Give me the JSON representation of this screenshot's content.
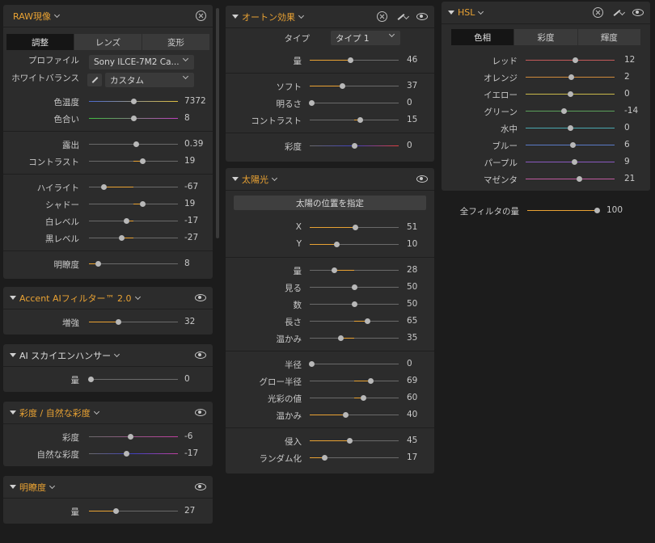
{
  "raw": {
    "title": "RAW現像",
    "tabs": [
      "調整",
      "レンズ",
      "変形"
    ],
    "profile_label": "プロファイル",
    "profile_value": "Sony ILCE-7M2 Ca...",
    "wb_label": "ホワイトバランス",
    "wb_value": "カスタム",
    "groups": [
      [
        {
          "label": "色温度",
          "value": "7372",
          "pos": 0.5
        },
        {
          "label": "色合い",
          "value": "8",
          "pos": 0.5
        }
      ],
      [
        {
          "label": "露出",
          "value": "0.39",
          "pos": 0.53
        },
        {
          "label": "コントラスト",
          "value": "19",
          "pos": 0.6
        }
      ],
      [
        {
          "label": "ハイライト",
          "value": "-67",
          "pos": 0.17
        },
        {
          "label": "シャドー",
          "value": "19",
          "pos": 0.6
        },
        {
          "label": "白レベル",
          "value": "-17",
          "pos": 0.42
        },
        {
          "label": "黒レベル",
          "value": "-27",
          "pos": 0.37
        }
      ],
      [
        {
          "label": "明瞭度",
          "value": "8",
          "pos": 0.1
        }
      ]
    ]
  },
  "accent": {
    "title": "Accent AIフィルター™ 2.0",
    "rows": [
      {
        "label": "増強",
        "value": "32",
        "pos": 0.33
      }
    ]
  },
  "sky": {
    "title": "AI スカイエンハンサー",
    "rows": [
      {
        "label": "量",
        "value": "0",
        "pos": 0.02
      }
    ]
  },
  "sat": {
    "title": "彩度 / 自然な彩度",
    "rows": [
      {
        "label": "彩度",
        "value": "-6",
        "pos": 0.47
      },
      {
        "label": "自然な彩度",
        "value": "-17",
        "pos": 0.42
      }
    ]
  },
  "clarity": {
    "title": "明瞭度",
    "rows": [
      {
        "label": "量",
        "value": "27",
        "pos": 0.3
      }
    ]
  },
  "auto": {
    "title": "オートン効果",
    "type_label": "タイプ",
    "type_value": "タイプ 1",
    "groups": [
      [
        {
          "label": "量",
          "value": "46",
          "pos": 0.46
        }
      ],
      [
        {
          "label": "ソフト",
          "value": "37",
          "pos": 0.37
        },
        {
          "label": "明るさ",
          "value": "0",
          "pos": 0.02
        },
        {
          "label": "コントラスト",
          "value": "15",
          "pos": 0.57
        }
      ],
      [
        {
          "label": "彩度",
          "value": "0",
          "pos": 0.5
        }
      ]
    ]
  },
  "sun": {
    "title": "太陽光",
    "button": "太陽の位置を指定",
    "groups": [
      [
        {
          "label": "X",
          "value": "51",
          "pos": 0.51
        },
        {
          "label": "Y",
          "value": "10",
          "pos": 0.3
        }
      ],
      [
        {
          "label": "量",
          "value": "28",
          "pos": 0.28
        },
        {
          "label": "見る",
          "value": "50",
          "pos": 0.5
        },
        {
          "label": "数",
          "value": "50",
          "pos": 0.5
        },
        {
          "label": "長さ",
          "value": "65",
          "pos": 0.65
        },
        {
          "label": "温かみ",
          "value": "35",
          "pos": 0.35
        }
      ],
      [
        {
          "label": "半径",
          "value": "0",
          "pos": 0.02
        },
        {
          "label": "グロー半径",
          "value": "69",
          "pos": 0.69
        },
        {
          "label": "光彩の値",
          "value": "60",
          "pos": 0.6
        },
        {
          "label": "温かみ",
          "value": "40",
          "pos": 0.4
        }
      ],
      [
        {
          "label": "侵入",
          "value": "45",
          "pos": 0.45
        },
        {
          "label": "ランダム化",
          "value": "17",
          "pos": 0.17
        }
      ]
    ]
  },
  "hsl": {
    "title": "HSL",
    "tabs": [
      "色相",
      "彩度",
      "輝度"
    ],
    "rows": [
      {
        "label": "レッド",
        "value": "12",
        "pos": 0.56,
        "color": "#c45a5a"
      },
      {
        "label": "オレンジ",
        "value": "2",
        "pos": 0.51,
        "color": "#d08a3a"
      },
      {
        "label": "イエロー",
        "value": "0",
        "pos": 0.5,
        "color": "#c9b84a"
      },
      {
        "label": "グリーン",
        "value": "-14",
        "pos": 0.43,
        "color": "#5aa05a"
      },
      {
        "label": "水中",
        "value": "0",
        "pos": 0.5,
        "color": "#4aa8b0"
      },
      {
        "label": "ブルー",
        "value": "6",
        "pos": 0.53,
        "color": "#5a7ac8"
      },
      {
        "label": "パープル",
        "value": "9",
        "pos": 0.55,
        "color": "#8a5ac0"
      },
      {
        "label": "マゼンタ",
        "value": "21",
        "pos": 0.6,
        "color": "#c05aa0"
      }
    ]
  },
  "global": {
    "label": "全フィルタの量",
    "value": "100",
    "pos": 1.0
  }
}
